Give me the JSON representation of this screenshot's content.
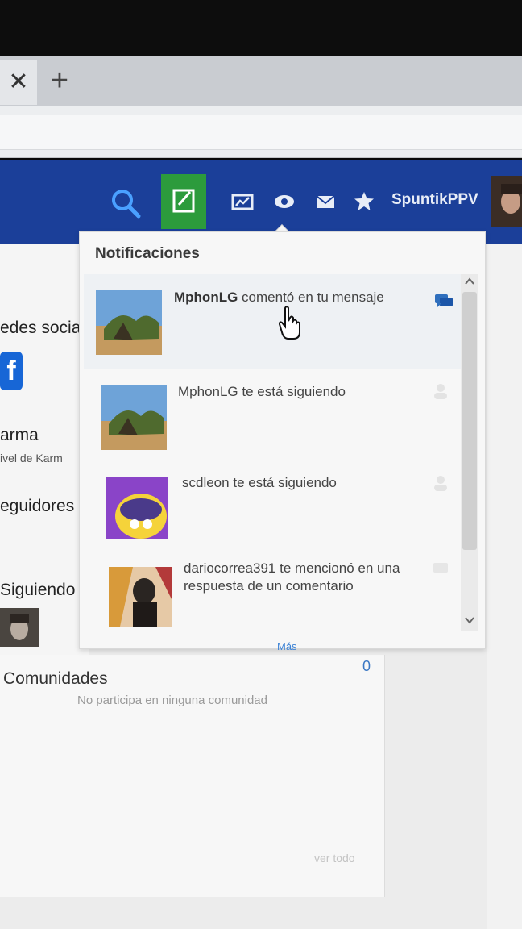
{
  "browser": {
    "tab_close_glyph": "✕",
    "new_tab_glyph": "+"
  },
  "navbar": {
    "username": "SpuntikPPV",
    "icons": [
      "search-icon",
      "write-icon",
      "stats-icon",
      "eye-icon",
      "mail-icon",
      "star-icon"
    ],
    "colors": {
      "bar": "#1b3f99",
      "write_button": "#2c9b3c",
      "search": "#4aa0ff"
    }
  },
  "sidebar": {
    "redes": "edes socia",
    "facebook_glyph": "f",
    "karma": "arma",
    "karma_level": "ivel de Karm",
    "seguidores": "eguidores",
    "siguiendo": "Siguiendo"
  },
  "comunidades": {
    "title": "Comunidades",
    "count": "0",
    "empty": "No participa en ninguna comunidad",
    "link": "ver todo"
  },
  "notifications": {
    "header": "Notificaciones",
    "items": [
      {
        "user": "MphonLG",
        "action": "comentó en tu mensaje",
        "icon": "comment-icon",
        "unread": true
      },
      {
        "user": "MphonLG",
        "action": "te está siguiendo",
        "icon": "follow-icon",
        "unread": false
      },
      {
        "user": "scdleon",
        "action": "te está siguiendo",
        "icon": "follow-icon",
        "unread": false
      },
      {
        "user": "dariocorrea391",
        "action": "te mencionó en una respuesta de un comentario",
        "icon": "mention-icon",
        "unread": false
      }
    ],
    "more": "Más"
  }
}
